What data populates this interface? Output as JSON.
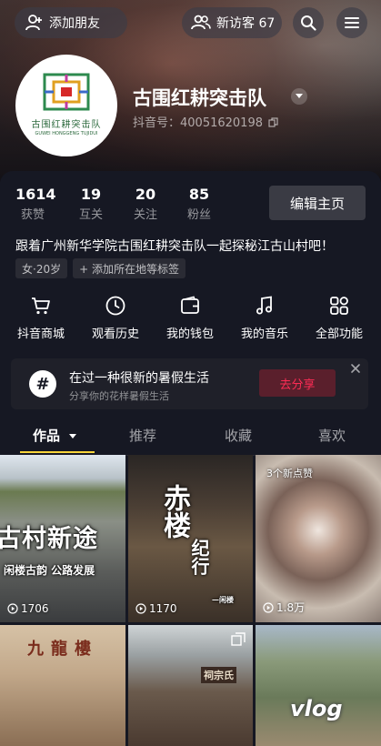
{
  "header": {
    "add_friend_label": "添加朋友",
    "visitors_label": "新访客 67",
    "nickname": "古围红耕突击队",
    "douyin_id": "抖音号：40051620198",
    "avatar_text": "古围红耕突击队",
    "avatar_subtext": "GUWEI HONGGENG TUJIDUI"
  },
  "stats": [
    {
      "value": "1614",
      "label": "获赞"
    },
    {
      "value": "19",
      "label": "互关"
    },
    {
      "value": "20",
      "label": "关注"
    },
    {
      "value": "85",
      "label": "粉丝"
    }
  ],
  "edit_profile_label": "编辑主页",
  "bio": "跟着广州新华学院古围红耕突击队一起探秘江古山村吧！",
  "tags": [
    "女·20岁",
    "+ 添加所在地等标签"
  ],
  "services": [
    {
      "label": "抖音商城",
      "icon": "cart-icon"
    },
    {
      "label": "观看历史",
      "icon": "clock-icon"
    },
    {
      "label": "我的钱包",
      "icon": "wallet-icon"
    },
    {
      "label": "我的音乐",
      "icon": "music-icon"
    },
    {
      "label": "全部功能",
      "icon": "grid-icon"
    }
  ],
  "promo": {
    "title": "在过一种很新的暑假生活",
    "subtitle": "分享你的花样暑假生活",
    "button": "去分享"
  },
  "tabs": [
    {
      "label": "作品",
      "active": true
    },
    {
      "label": "推荐",
      "active": false
    },
    {
      "label": "收藏",
      "active": false
    },
    {
      "label": "喜欢",
      "active": false
    }
  ],
  "videos": [
    {
      "overlay": "古村新途",
      "overlay2": "闲楼古韵 公路发展",
      "likes": "1706"
    },
    {
      "overlay": "赤楼",
      "overlay2": "纪行",
      "caption": "—闲楼",
      "likes": "1170"
    },
    {
      "badge": "3个新点赞",
      "likes": "1.8万"
    },
    {
      "overlay": "九龍樓"
    },
    {
      "overlay": "祠宗氏"
    },
    {
      "overlay": "vlog"
    }
  ],
  "colors": {
    "background": "#161823",
    "accent_yellow": "#fbd53a",
    "share_red": "#fe2c55"
  }
}
